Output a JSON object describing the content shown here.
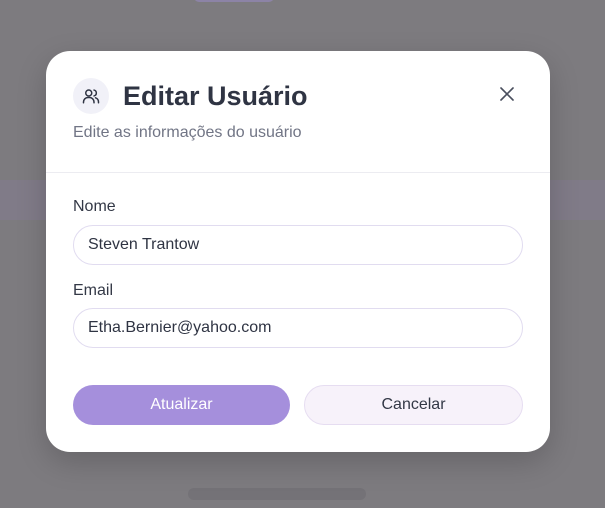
{
  "dialog": {
    "title": "Editar Usuário",
    "subtitle": "Edite as informações do usuário",
    "title_icon": "users-icon",
    "close_icon": "close-icon"
  },
  "form": {
    "name_label": "Nome",
    "name_value": "Steven Trantow",
    "email_label": "Email",
    "email_value": "Etha.Bernier@yahoo.com"
  },
  "actions": {
    "update_label": "Atualizar",
    "cancel_label": "Cancelar"
  },
  "colors": {
    "primary": "#a58fdc",
    "secondary_bg": "#f7f2fa",
    "text": "#2f3443",
    "muted": "#717585"
  }
}
